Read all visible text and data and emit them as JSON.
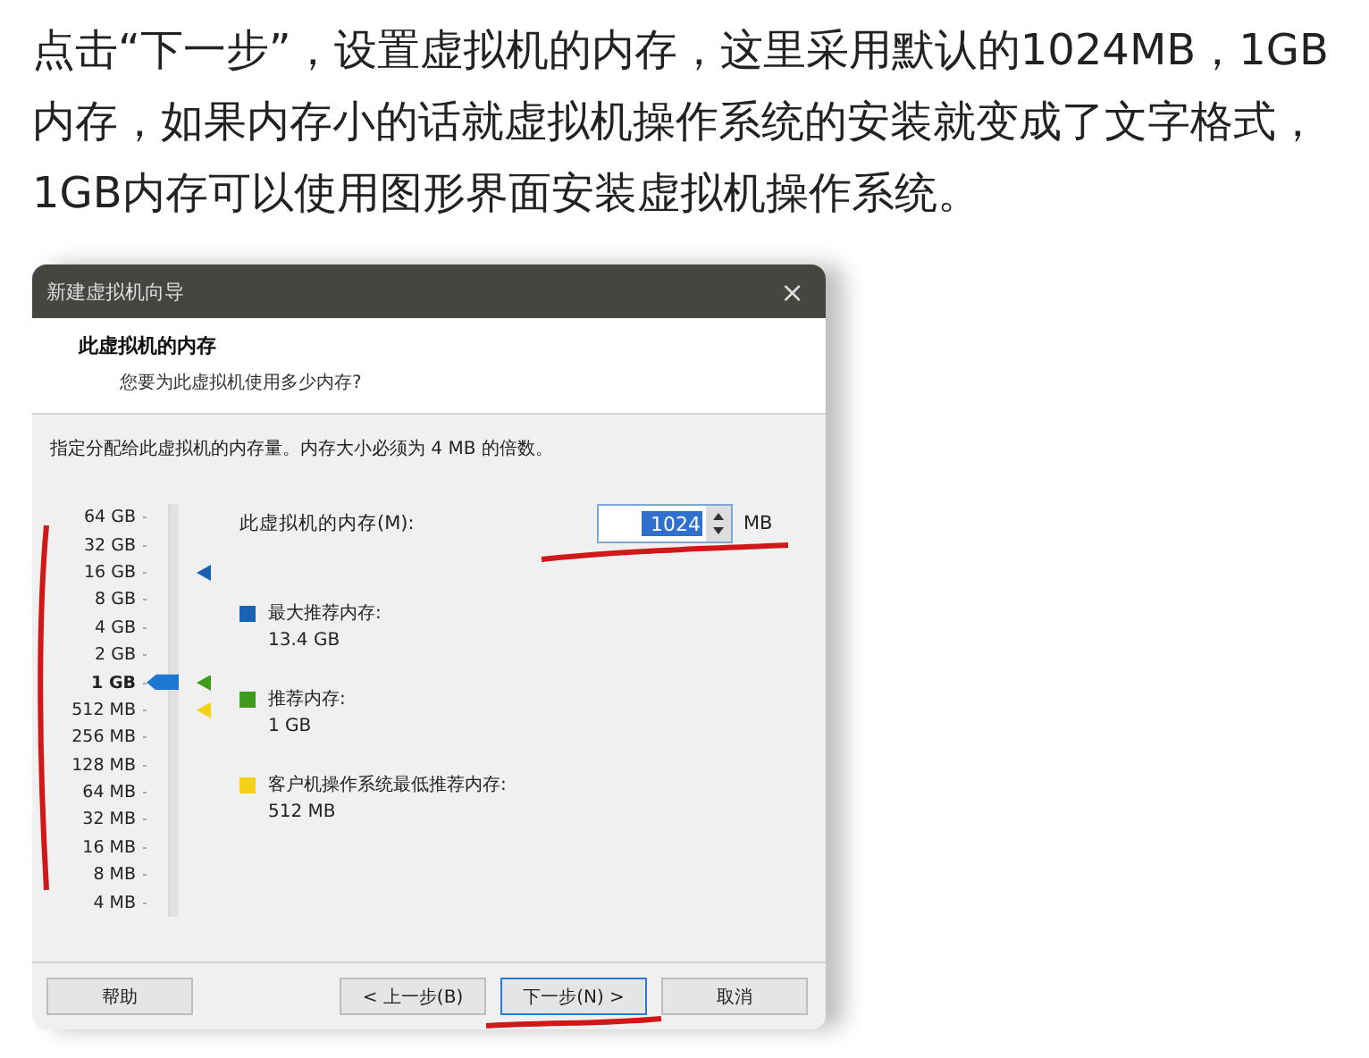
{
  "article": {
    "paragraph": "点击“下一步”，设置虚拟机的内存，这里采用默认的1024MB，1GB内存，如果内存小的话就虚拟机操作系统的安装就变成了文字格式，1GB内存可以使用图形界面安装虚拟机操作系统。"
  },
  "dialog": {
    "title": "新建虚拟机向导",
    "close": "×",
    "heading": "此虚拟机的内存",
    "subheading": "您要为此虚拟机使用多少内存?",
    "instruction": "指定分配给此虚拟机的内存量。内存大小必须为 4 MB 的倍数。",
    "memory_label": "此虚拟机的内存(M):",
    "memory_value": "1024",
    "unit": "MB",
    "scale": [
      {
        "label": "64 GB",
        "selected": false
      },
      {
        "label": "32 GB",
        "selected": false
      },
      {
        "label": "16 GB",
        "selected": false,
        "color": "#1a62b0"
      },
      {
        "label": "8 GB",
        "selected": false
      },
      {
        "label": "4 GB",
        "selected": false
      },
      {
        "label": "2 GB",
        "selected": false
      },
      {
        "label": "1 GB",
        "selected": true,
        "color": "#3f9a1e"
      },
      {
        "label": "512 MB",
        "selected": false,
        "color": "#f3d01a"
      },
      {
        "label": "256 MB",
        "selected": false
      },
      {
        "label": "128 MB",
        "selected": false
      },
      {
        "label": "64 MB",
        "selected": false
      },
      {
        "label": "32 MB",
        "selected": false
      },
      {
        "label": "16 MB",
        "selected": false
      },
      {
        "label": "8 MB",
        "selected": false
      },
      {
        "label": "4 MB",
        "selected": false
      }
    ],
    "legend": [
      {
        "label": "最大推荐内存:",
        "value": "13.4 GB",
        "color": "#1a62b0"
      },
      {
        "label": "推荐内存:",
        "value": "1 GB",
        "color": "#3f9a1e"
      },
      {
        "label": "客户机操作系统最低推荐内存:",
        "value": "512 MB",
        "color": "#f3d01a"
      }
    ],
    "buttons": [
      {
        "label": "帮助",
        "kind": "plain"
      },
      {
        "label": "< 上一步(B)",
        "kind": "plain"
      },
      {
        "label": "下一步(N) >",
        "kind": "default"
      },
      {
        "label": "取消",
        "kind": "plain"
      }
    ]
  }
}
